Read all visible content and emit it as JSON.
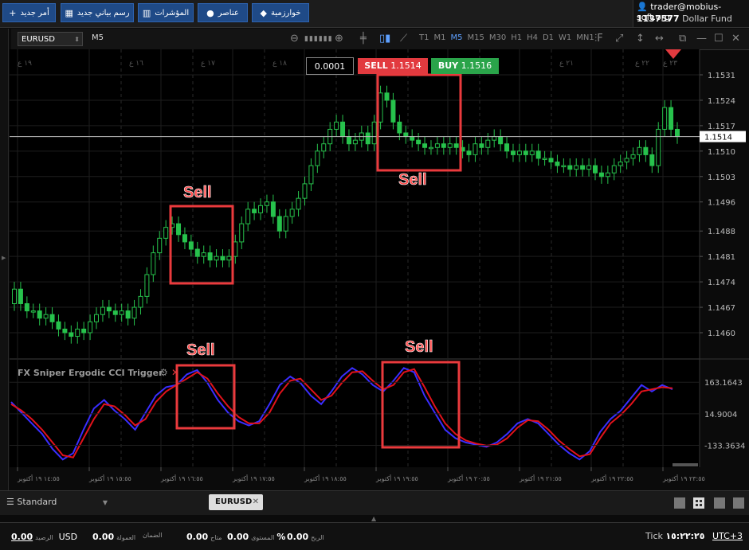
{
  "topbar": {
    "buttons": [
      {
        "label": "أمر جديد",
        "icon": "+"
      },
      {
        "label": "رسم بياني جديد",
        "icon": "▦"
      },
      {
        "label": "المؤشرات",
        "icon": "▥"
      },
      {
        "label": "عناصر",
        "icon": "●"
      },
      {
        "label": "خوارزمية",
        "icon": "◆"
      }
    ],
    "user_email": "trader@mobius-soft.org",
    "account_number": "1137577",
    "account_fund": "Dollar Fund"
  },
  "toolbar": {
    "symbol": "EURUSD",
    "timeframe": "M5",
    "timeframes": [
      "T1",
      "M1",
      "M5",
      "M15",
      "M30",
      "H1",
      "H4",
      "D1",
      "W1",
      "MN1"
    ],
    "active_timeframe": "M5"
  },
  "trade": {
    "lot": "0.0001",
    "sell_label": "SELL",
    "sell_price": "1.1514",
    "buy_label": "BUY",
    "buy_price": "1.1516",
    "sell_color": "#e23a3f",
    "buy_color": "#2aa44a"
  },
  "annotations": [
    "Sell",
    "Sell",
    "Sell",
    "Sell"
  ],
  "chart_data": {
    "type": "candlestick",
    "symbol": "EURUSD",
    "price_axis_ticks": [
      "1.1531",
      "1.1524",
      "1.1517",
      "1.1510",
      "1.1503",
      "1.1496",
      "1.1488",
      "1.1481",
      "1.1474",
      "1.1467",
      "1.1460"
    ],
    "current_price": "1.1514",
    "date_marks_top": [
      "١٩ ع",
      "١٦ ع",
      "١٧ ع",
      "١٨ ع",
      "٢١ ع",
      "٢٢ ع",
      "٢٣ ع"
    ],
    "time_axis": [
      "١٤:٥٥ ١٩ أكتوبر",
      "١٥:٥٥ ١٩ أكتوبر",
      "١٦:٥٥ ١٩ أكتوبر",
      "١٧:٥٥ ١٩ أكتوبر",
      "١٨:٥٥ ١٩ أكتوبر",
      "١٩:٥٥ ١٩ أكتوبر",
      "٢٠:٥٥ ١٩ أكتوبر",
      "٢١:٥٥ ١٩ أكتوبر",
      "٢٢:٥٥ ١٩ أكتوبر",
      "٢٣:٥٥ ١٩ أكتوبر"
    ],
    "closes": [
      1.1472,
      1.1468,
      1.1466,
      1.1466,
      1.1464,
      1.1465,
      1.1463,
      1.1461,
      1.146,
      1.1459,
      1.1461,
      1.146,
      1.1463,
      1.1465,
      1.1467,
      1.1466,
      1.1465,
      1.1466,
      1.1464,
      1.1467,
      1.147,
      1.1476,
      1.1482,
      1.1486,
      1.1489,
      1.149,
      1.1487,
      1.1485,
      1.1483,
      1.1481,
      1.1482,
      1.148,
      1.1481,
      1.148,
      1.1481,
      1.1485,
      1.149,
      1.1494,
      1.1493,
      1.1495,
      1.1496,
      1.1492,
      1.1488,
      1.1492,
      1.1494,
      1.1497,
      1.1501,
      1.1506,
      1.151,
      1.1512,
      1.1516,
      1.1518,
      1.1514,
      1.1512,
      1.1513,
      1.1515,
      1.1512,
      1.1518,
      1.1526,
      1.1524,
      1.1518,
      1.1515,
      1.1514,
      1.1513,
      1.1512,
      1.1511,
      1.1511,
      1.1512,
      1.1511,
      1.1512,
      1.1511,
      1.151,
      1.1509,
      1.1512,
      1.1511,
      1.1513,
      1.1514,
      1.1512,
      1.151,
      1.1509,
      1.151,
      1.1509,
      1.151,
      1.1508,
      1.1508,
      1.1507,
      1.1506,
      1.1506,
      1.1505,
      1.1506,
      1.1505,
      1.1506,
      1.1504,
      1.1503,
      1.1504,
      1.1506,
      1.1507,
      1.1508,
      1.1509,
      1.1511,
      1.1509,
      1.1506,
      1.1516,
      1.1522,
      1.1516,
      1.1514
    ],
    "indicator": {
      "name": "FX Sniper Ergodic CCI Trigger",
      "ticks": [
        "163.1643",
        "14.9004",
        "-133.3634"
      ],
      "ylim": [
        -210,
        250
      ],
      "series": [
        {
          "color": "#3a2dff",
          "values": [
            70,
            20,
            -30,
            -80,
            -150,
            -200,
            -170,
            -60,
            40,
            80,
            30,
            -10,
            -60,
            20,
            100,
            140,
            150,
            200,
            220,
            160,
            80,
            20,
            -20,
            -40,
            -20,
            60,
            150,
            190,
            160,
            100,
            60,
            120,
            190,
            230,
            200,
            150,
            120,
            170,
            230,
            210,
            100,
            20,
            -60,
            -100,
            -120,
            -130,
            -140,
            -120,
            -80,
            -30,
            -10,
            -30,
            -80,
            -130,
            -170,
            -200,
            -160,
            -70,
            -10,
            30,
            90,
            150,
            120,
            150,
            130
          ]
        },
        {
          "color": "#e2121b",
          "values": [
            60,
            30,
            -10,
            -60,
            -120,
            -180,
            -190,
            -100,
            -10,
            60,
            50,
            10,
            -40,
            -10,
            70,
            120,
            150,
            180,
            210,
            180,
            110,
            50,
            0,
            -30,
            -30,
            20,
            110,
            170,
            180,
            130,
            80,
            100,
            160,
            210,
            215,
            170,
            130,
            150,
            210,
            225,
            140,
            50,
            -30,
            -80,
            -110,
            -125,
            -135,
            -130,
            -100,
            -50,
            -15,
            -20,
            -60,
            -110,
            -150,
            -185,
            -175,
            -100,
            -30,
            10,
            60,
            120,
            130,
            140,
            135
          ]
        }
      ]
    }
  },
  "bottom": {
    "layout_label": "Standard",
    "active_tab": "EURUSD"
  },
  "status": {
    "balance_value": "0.00",
    "balance_label": "الرصيد",
    "currency": "USD",
    "commission_value": "0.00",
    "commission_label": "العمولة",
    "margin_value": "",
    "margin_label": "الضمان",
    "free_value": "0.00",
    "free_label": "متاح",
    "level_value": "0.00",
    "level_label": "المستوى",
    "level_suffix": "%",
    "profit_value": "0.00",
    "profit_label": "الربح",
    "mode": "Tick",
    "time": "١٥:٢٢:٢٥",
    "timezone": "UTC+3"
  }
}
